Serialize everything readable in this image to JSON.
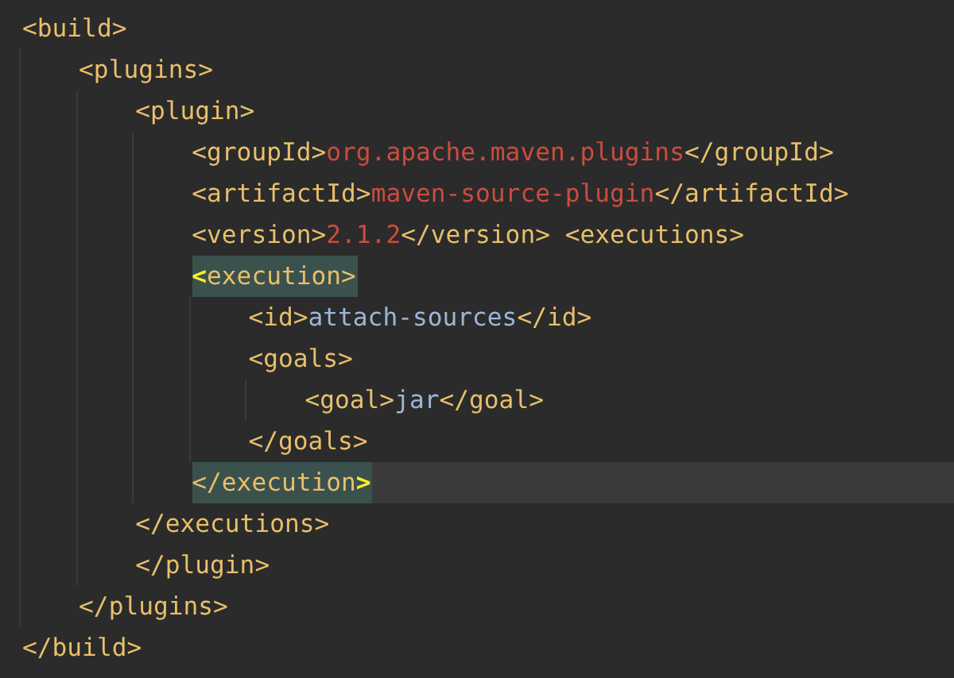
{
  "editor": {
    "lines": [
      {
        "tokens": [
          {
            "kind": "tag",
            "text": "<build>"
          }
        ],
        "highlighted": false,
        "current": false,
        "children": [
          {
            "tokens": [
              {
                "kind": "tag",
                "text": "<plugins>"
              }
            ],
            "highlighted": false,
            "current": false,
            "children": [
              {
                "tokens": [
                  {
                    "kind": "tag",
                    "text": "<plugin>"
                  }
                ],
                "highlighted": false,
                "current": false,
                "children": [
                  {
                    "tokens": [
                      {
                        "kind": "tag",
                        "text": "<groupId>"
                      },
                      {
                        "kind": "value",
                        "text": "org.apache.maven.plugins"
                      },
                      {
                        "kind": "tag",
                        "text": "</groupId>"
                      }
                    ],
                    "highlighted": false,
                    "current": false
                  },
                  {
                    "tokens": [
                      {
                        "kind": "tag",
                        "text": "<artifactId>"
                      },
                      {
                        "kind": "value",
                        "text": "maven-source-plugin"
                      },
                      {
                        "kind": "tag",
                        "text": "</artifactId>"
                      }
                    ],
                    "highlighted": false,
                    "current": false
                  },
                  {
                    "tokens": [
                      {
                        "kind": "tag",
                        "text": "<version>"
                      },
                      {
                        "kind": "value",
                        "text": "2.1.2"
                      },
                      {
                        "kind": "tag",
                        "text": "</version> <executions>"
                      }
                    ],
                    "highlighted": false,
                    "current": false
                  },
                  {
                    "tokens": [
                      {
                        "kind": "match",
                        "text": "<"
                      },
                      {
                        "kind": "tag",
                        "text": "execution>"
                      }
                    ],
                    "highlighted": true,
                    "current": false,
                    "children": [
                      {
                        "tokens": [
                          {
                            "kind": "tag",
                            "text": "<id>"
                          },
                          {
                            "kind": "text",
                            "text": "attach-sources"
                          },
                          {
                            "kind": "tag",
                            "text": "</id>"
                          }
                        ],
                        "highlighted": false,
                        "current": false
                      },
                      {
                        "tokens": [
                          {
                            "kind": "tag",
                            "text": "<goals>"
                          }
                        ],
                        "highlighted": false,
                        "current": false,
                        "children": [
                          {
                            "tokens": [
                              {
                                "kind": "tag",
                                "text": "<goal>"
                              },
                              {
                                "kind": "text",
                                "text": "jar"
                              },
                              {
                                "kind": "tag",
                                "text": "</goal>"
                              }
                            ],
                            "highlighted": false,
                            "current": false
                          }
                        ]
                      },
                      {
                        "tokens": [
                          {
                            "kind": "tag",
                            "text": "</goals>"
                          }
                        ],
                        "highlighted": false,
                        "current": false
                      }
                    ]
                  },
                  {
                    "tokens": [
                      {
                        "kind": "tag",
                        "text": "</execution"
                      },
                      {
                        "kind": "match",
                        "text": ">"
                      }
                    ],
                    "highlighted": true,
                    "current": true
                  }
                ]
              },
              {
                "tokens": [
                  {
                    "kind": "tag",
                    "text": "</executions>"
                  }
                ],
                "highlighted": false,
                "current": false
              },
              {
                "tokens": [
                  {
                    "kind": "tag",
                    "text": "</plugin>"
                  }
                ],
                "highlighted": false,
                "current": false
              }
            ]
          },
          {
            "tokens": [
              {
                "kind": "tag",
                "text": "</plugins>"
              }
            ],
            "highlighted": false,
            "current": false
          }
        ]
      },
      {
        "tokens": [
          {
            "kind": "tag",
            "text": "</build>"
          }
        ],
        "highlighted": false,
        "current": false
      }
    ]
  }
}
